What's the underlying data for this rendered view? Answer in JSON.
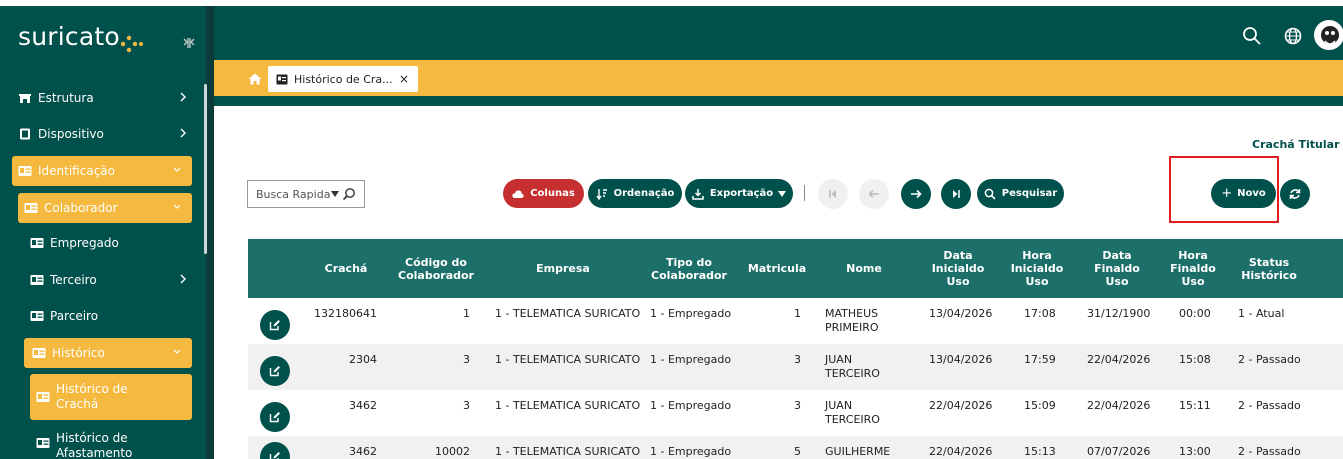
{
  "app": {
    "logo_text": "suricato"
  },
  "sidebar": {
    "items": [
      {
        "label": "Estrutura",
        "icon": "building-icon"
      },
      {
        "label": "Dispositivo",
        "icon": "device-icon"
      },
      {
        "label": "Identificação",
        "icon": "id-card-icon"
      },
      {
        "label": "Colaborador",
        "icon": "id-card-icon"
      },
      {
        "label": "Empregado",
        "icon": "id-card-icon"
      },
      {
        "label": "Terceiro",
        "icon": "id-card-icon"
      },
      {
        "label": "Parceiro",
        "icon": "id-card-icon"
      },
      {
        "label": "Histórico",
        "icon": "id-card-icon"
      },
      {
        "label_line1": "Histórico de",
        "label_line2": "Crachá",
        "icon": "id-card-icon"
      },
      {
        "label_line1": "Histórico de",
        "label_line2": "Afastamento",
        "icon": "id-card-icon"
      }
    ]
  },
  "tabs": [
    {
      "label": "Histórico de Cra...",
      "close": "×"
    }
  ],
  "content": {
    "cracha_link": "Crachá Titular"
  },
  "toolbar": {
    "search_placeholder": "Busca Rapida",
    "colunas": "Colunas",
    "ordenacao": "Ordenação",
    "exportacao": "Exportação",
    "pesquisar": "Pesquisar",
    "novo": "Novo"
  },
  "table": {
    "headers": [
      [
        "Crachá"
      ],
      [
        "Código do",
        "Colaborador"
      ],
      [
        "Empresa"
      ],
      [
        "Tipo do",
        "Colaborador"
      ],
      [
        "Matricula"
      ],
      [
        "Nome"
      ],
      [
        "Data",
        "Inicialdo",
        "Uso"
      ],
      [
        "Hora",
        "Inicialdo",
        "Uso"
      ],
      [
        "Data",
        "Finaldo",
        "Uso"
      ],
      [
        "Hora",
        "Finaldo",
        "Uso"
      ],
      [
        "Status",
        "Histórico"
      ]
    ],
    "rows": [
      {
        "cracha": "132180641",
        "codigo": "1",
        "empresa": "1 - TELEMATICA SURICATO",
        "tipo": "1 - Empregado",
        "matricula": "1",
        "nome1": "MATHEUS",
        "nome2": "PRIMEIRO",
        "data_ini": "13/04/2026",
        "hora_ini": "17:08",
        "data_fim": "31/12/1900",
        "hora_fim": "00:00",
        "status": "1 - Atual"
      },
      {
        "cracha": "2304",
        "codigo": "3",
        "empresa": "1 - TELEMATICA SURICATO",
        "tipo": "1 - Empregado",
        "matricula": "3",
        "nome1": "JUAN",
        "nome2": "TERCEIRO",
        "data_ini": "13/04/2026",
        "hora_ini": "17:59",
        "data_fim": "22/04/2026",
        "hora_fim": "15:08",
        "status": "2 - Passado"
      },
      {
        "cracha": "3462",
        "codigo": "3",
        "empresa": "1 - TELEMATICA SURICATO",
        "tipo": "1 - Empregado",
        "matricula": "3",
        "nome1": "JUAN",
        "nome2": "TERCEIRO",
        "data_ini": "22/04/2026",
        "hora_ini": "15:09",
        "data_fim": "22/04/2026",
        "hora_fim": "15:11",
        "status": "2 - Passado"
      },
      {
        "cracha": "3462",
        "codigo": "10002",
        "empresa": "1 - TELEMATICA SURICATO",
        "tipo": "1 - Empregado",
        "matricula": "5",
        "nome1": "GUILHERME",
        "nome2": "",
        "data_ini": "22/04/2026",
        "hora_ini": "15:13",
        "data_fim": "07/07/2026",
        "hora_fim": "13:00",
        "status": "2 - Passado"
      }
    ]
  },
  "colors": {
    "primary": "#00504b",
    "accent": "#f4b93e",
    "danger": "#c62f2f",
    "table_header": "#1d6f6a"
  }
}
